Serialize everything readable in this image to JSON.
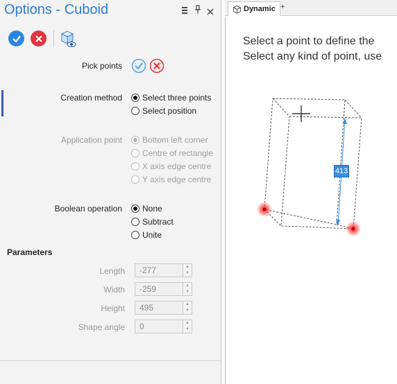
{
  "panel": {
    "title": "Options - Cuboid",
    "title_icons": [
      "list-icon",
      "pin-icon",
      "close-icon"
    ],
    "pick_points_label": "Pick points",
    "creation_method": {
      "label": "Creation method",
      "options": [
        "Select three points",
        "Select position"
      ],
      "selected": 0
    },
    "application_point": {
      "label": "Application point",
      "options": [
        "Bottom left corner",
        "Centre of rectangle",
        "X axis edge centre",
        "Y axis edge centre"
      ],
      "selected": 0
    },
    "boolean_operation": {
      "label": "Boolean operation",
      "options": [
        "None",
        "Subtract",
        "Unite"
      ],
      "selected": 0
    },
    "parameters": {
      "header": "Parameters",
      "fields": [
        {
          "label": "Length",
          "value": "-277"
        },
        {
          "label": "Width",
          "value": "-259"
        },
        {
          "label": "Height",
          "value": "495"
        },
        {
          "label": "Shape angle",
          "value": "0"
        }
      ]
    }
  },
  "view": {
    "tab_label": "Dynamic",
    "new_tab": "+",
    "message_line1": "Select a point to define the",
    "message_line2": "Select any kind of point, use",
    "dimension_value": "413"
  },
  "colors": {
    "accent": "#2c7bd6",
    "ok": "#2b86e0",
    "cancel": "#e0353f",
    "point": "#ff2020"
  }
}
